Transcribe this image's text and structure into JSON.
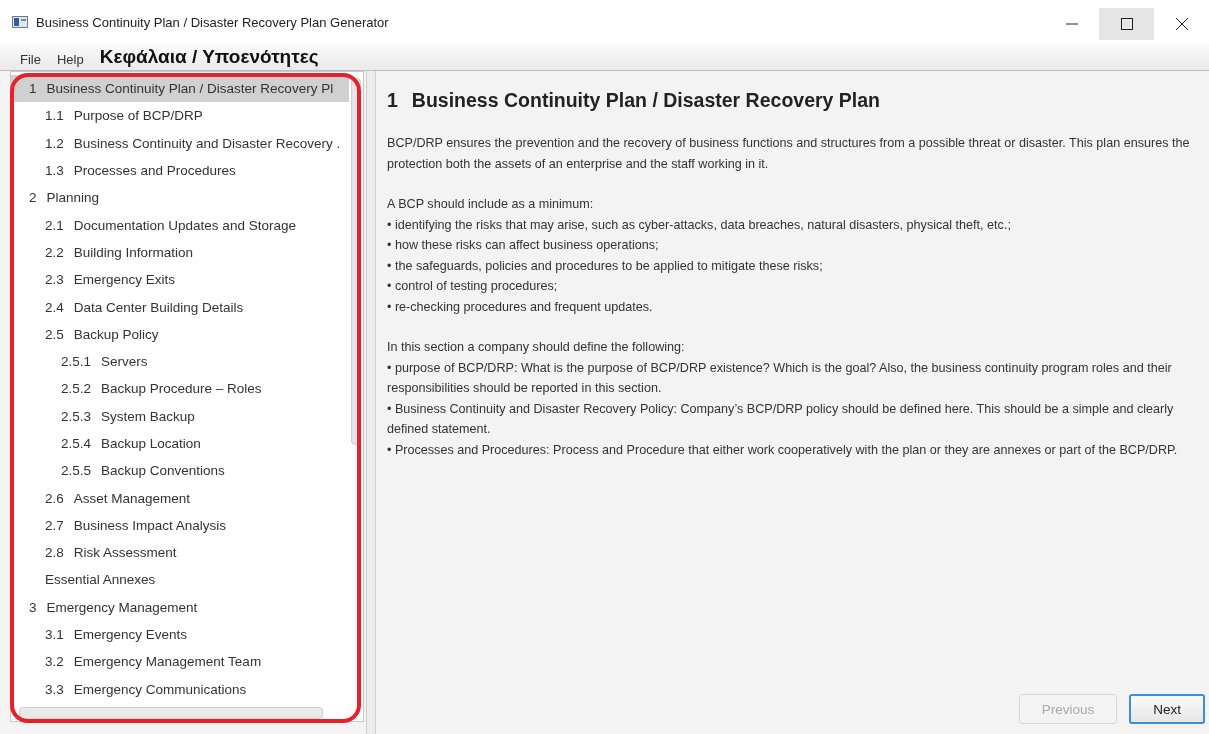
{
  "window": {
    "title": "Business Continuity Plan / Disaster Recovery Plan Generator"
  },
  "menu": [
    {
      "label": "File"
    },
    {
      "label": "Help"
    }
  ],
  "annotation": {
    "label": "Κεφάλαια / Υποενότητες"
  },
  "tree": [
    {
      "number": "1",
      "title": "Business Continuity Plan / Disaster Recovery Pl",
      "selected": true,
      "children": [
        {
          "number": "1.1",
          "title": "Purpose of BCP/DRP",
          "selected": false
        },
        {
          "number": "1.2",
          "title": "Business Continuity and Disaster Recovery .",
          "selected": false
        },
        {
          "number": "1.3",
          "title": "Processes and Procedures",
          "selected": false
        }
      ]
    },
    {
      "number": "2",
      "title": "Planning",
      "selected": false,
      "children": [
        {
          "number": "2.1",
          "title": "Documentation Updates and Storage",
          "selected": false
        },
        {
          "number": "2.2",
          "title": "Building Information",
          "selected": false
        },
        {
          "number": "2.3",
          "title": "Emergency Exits",
          "selected": false
        },
        {
          "number": "2.4",
          "title": "Data Center Building Details",
          "selected": false
        },
        {
          "number": "2.5",
          "title": "Backup Policy",
          "selected": false,
          "children": [
            {
              "number": "2.5.1",
              "title": "Servers",
              "selected": false
            },
            {
              "number": "2.5.2",
              "title": "Backup Procedure – Roles",
              "selected": false
            },
            {
              "number": "2.5.3",
              "title": "System Backup",
              "selected": false
            },
            {
              "number": "2.5.4",
              "title": "Backup Location",
              "selected": false
            },
            {
              "number": "2.5.5",
              "title": "Backup Conventions",
              "selected": false
            }
          ]
        },
        {
          "number": "2.6",
          "title": "Asset Management",
          "selected": false
        },
        {
          "number": "2.7",
          "title": "Business Impact Analysis",
          "selected": false
        },
        {
          "number": "2.8",
          "title": "Risk Assessment",
          "selected": false
        },
        {
          "title": "Essential Annexes",
          "selected": false
        }
      ]
    },
    {
      "number": "3",
      "title": "Emergency Management",
      "selected": false,
      "children": [
        {
          "number": "3.1",
          "title": "Emergency Events",
          "selected": false
        },
        {
          "number": "3.2",
          "title": "Emergency Management Team",
          "selected": false
        },
        {
          "number": "3.3",
          "title": "Emergency Communications",
          "selected": false
        }
      ]
    }
  ],
  "content": {
    "heading_number": "1",
    "heading": "Business Continuity Plan / Disaster Recovery Plan",
    "blocks": [
      [
        "BCP/DRP ensures the prevention and the recovery of business functions and structures from a possible threat or disaster. This plan ensures the protection both the assets of an enterprise and the staff working in it."
      ],
      [
        "A BCP should include as a minimum:",
        "• identifying the risks that may arise, such as cyber-attacks, data breaches, natural disasters, physical theft, etc.;",
        "• how these risks can affect business operations;",
        "• the safeguards, policies and procedures to be applied to mitigate these risks;",
        "• control of testing procedures;",
        "• re-checking procedures and frequent updates."
      ],
      [
        "In this section a company should define the following:",
        "• purpose of BCP/DRP: What is the purpose of BCP/DRP existence? Which is the goal? Also, the business continuity program roles and their responsibilities should be reported in this section.",
        "• Business Continuity and Disaster Recovery Policy: Company’s BCP/DRP policy should be defined here. This should be a simple and clearly defined statement.",
        "• Processes and Procedures: Process and Procedure that either work cooperatively with the plan or they are annexes or part of the BCP/DRP."
      ]
    ]
  },
  "buttons": [
    {
      "label": "Previous",
      "disabled": true
    },
    {
      "label": "Next",
      "disabled": false
    }
  ]
}
